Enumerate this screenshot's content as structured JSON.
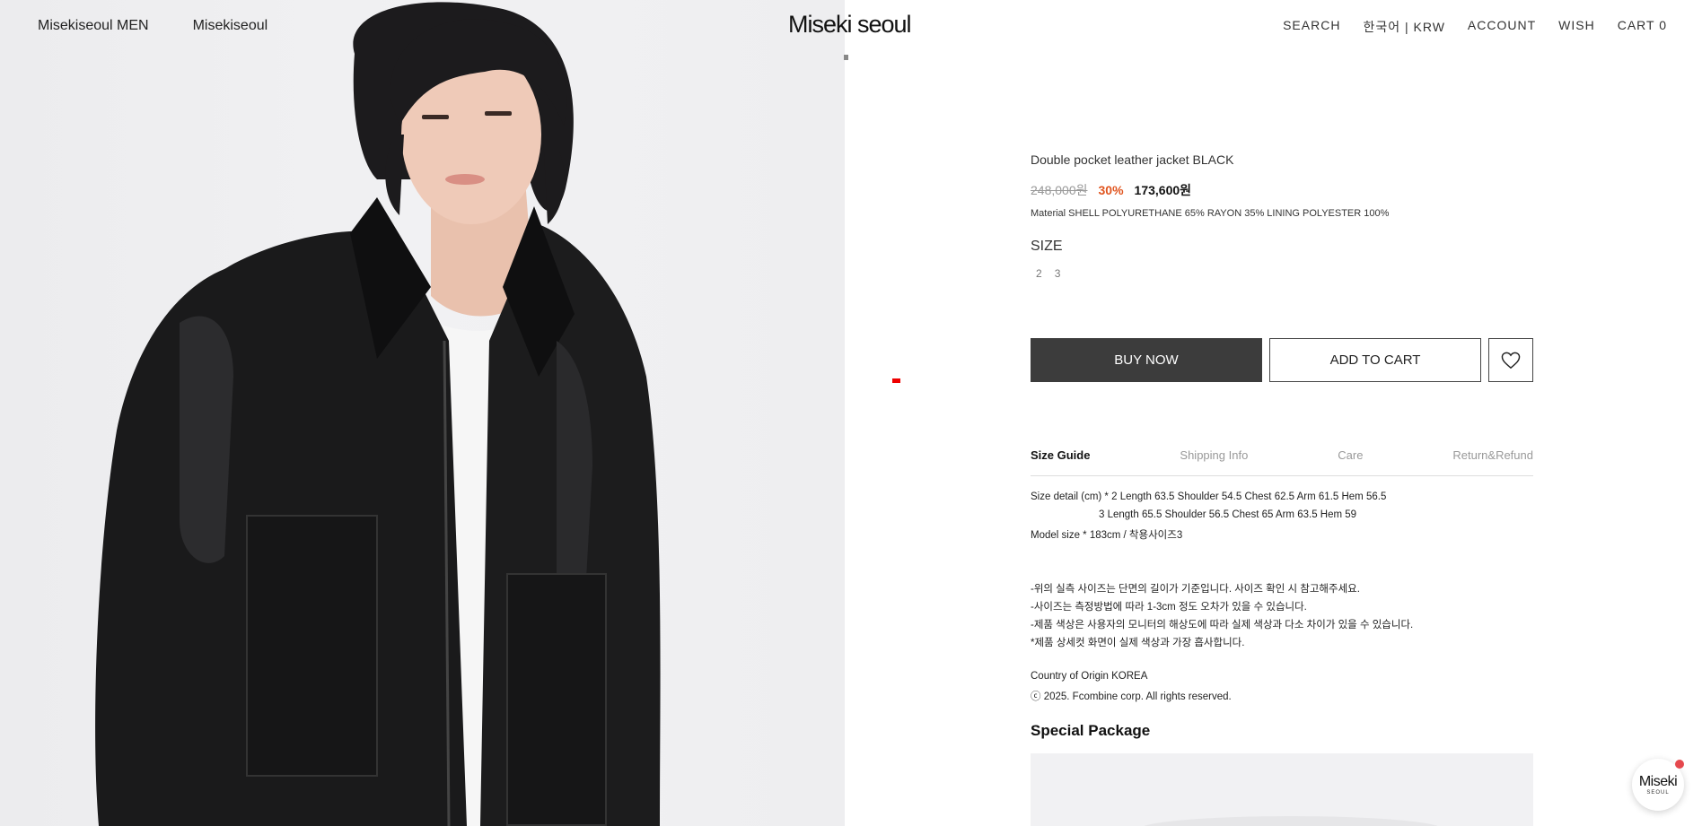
{
  "header": {
    "nav_left": [
      "Misekiseoul MEN",
      "Misekiseoul"
    ],
    "logo": "Miseki seoul",
    "nav_right": [
      "SEARCH",
      "한국어 | KRW",
      "ACCOUNT",
      "WISH",
      "CART 0"
    ]
  },
  "product": {
    "title": "Double pocket leather jacket BLACK",
    "original_price": "248,000원",
    "discount": "30%",
    "price": "173,600원",
    "material": "Material SHELL POLYURETHANE 65% RAYON 35% LINING POLYESTER 100%",
    "size_label": "SIZE",
    "sizes": [
      "2",
      "3"
    ],
    "buy_now": "BUY NOW",
    "add_to_cart": "ADD TO CART"
  },
  "tabs": [
    "Size Guide",
    "Shipping Info",
    "Care",
    "Return&Refund"
  ],
  "size_guide": {
    "line1": "Size detail (cm) *   2 Length 63.5 Shoulder 54.5 Chest 62.5 Arm 61.5 Hem 56.5",
    "line2": "3 Length 65.5 Shoulder 56.5 Chest 65 Arm 63.5 Hem 59",
    "line3": "Model size       *  183cm / 착용사이즈3",
    "note1": "-위의 실측 사이즈는 단면의 길이가 기준입니다. 사이즈 확인 시 참고해주세요.",
    "note2": "-사이즈는 측정방법에 따라 1-3cm 정도 오차가 있을 수 있습니다.",
    "note3": "-제품 색상은 사용자의 모니터의 해상도에 따라 실제 색상과 다소 차이가 있을 수 있습니다.",
    "note4": "*제품 상세컷 화면이 실제 색상과 가장 흡사합니다.",
    "origin": "Country of Origin KOREA",
    "copyright": "ⓒ 2025. Fcombine corp. All rights reserved."
  },
  "special_package": "Special Package",
  "chat_badge": {
    "line1": "Miseki",
    "line2": "SEOUL"
  },
  "colors": {
    "buy_button": "#3c3c3c",
    "discount": "#e0551f",
    "badge_dot": "#e5484d"
  }
}
